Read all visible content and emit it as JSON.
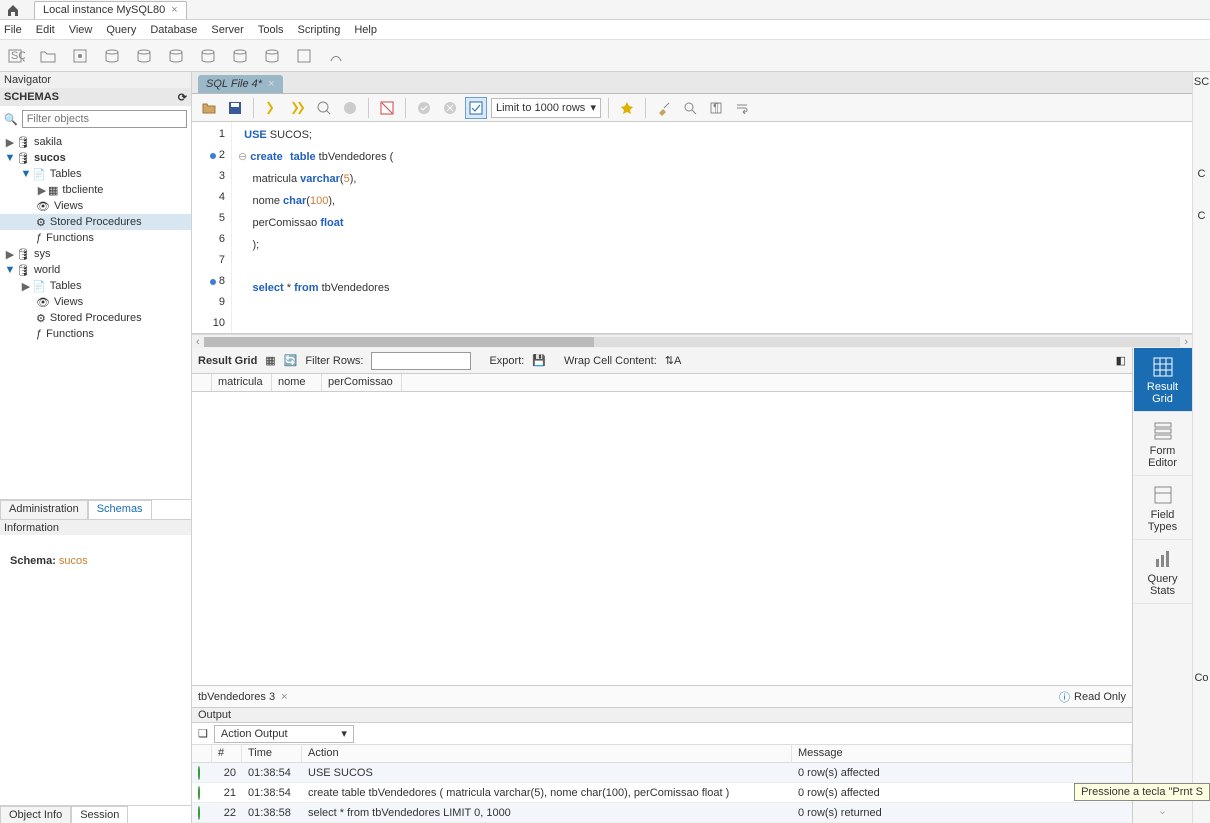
{
  "title_tab": "Local instance MySQL80",
  "menus": [
    "File",
    "Edit",
    "View",
    "Query",
    "Database",
    "Server",
    "Tools",
    "Scripting",
    "Help"
  ],
  "navigator_label": "Navigator",
  "schemas_label": "SCHEMAS",
  "filter_placeholder": "Filter objects",
  "tree": {
    "sakila": "sakila",
    "sucos": "sucos",
    "tables": "Tables",
    "tbcliente": "tbcliente",
    "views": "Views",
    "stored": "Stored Procedures",
    "functions": "Functions",
    "sys": "sys",
    "world": "world"
  },
  "nav_tabs": {
    "admin": "Administration",
    "schemas": "Schemas"
  },
  "info_label": "Information",
  "schema_prefix": "Schema: ",
  "schema_value": "sucos",
  "bottom_tabs": {
    "objinfo": "Object Info",
    "session": "Session"
  },
  "sql_tab": "SQL File 4*",
  "limit_label": "Limit to 1000 rows",
  "code": {
    "l1_kw": "USE",
    "l1_rest": " SUCOS;",
    "l2_kw1": "create",
    "l2_kw2": "table",
    "l2_rest": " tbVendedores (",
    "l3_a": "matricula ",
    "l3_kw": "varchar",
    "l3_b": "(",
    "l3_n": "5",
    "l3_c": "),",
    "l4_a": "nome ",
    "l4_kw": "char",
    "l4_b": "(",
    "l4_n": "100",
    "l4_c": "),",
    "l5_a": "perComissao ",
    "l5_kw": "float",
    "l6": ");",
    "l8_kw1": "select",
    "l8_b": " * ",
    "l8_kw2": "from",
    "l8_c": " tbVendedores"
  },
  "line_numbers": [
    "1",
    "2",
    "3",
    "4",
    "5",
    "6",
    "7",
    "8",
    "9",
    "10"
  ],
  "resultbar": {
    "label": "Result Grid",
    "filter": "Filter Rows:",
    "export": "Export:",
    "wrap": "Wrap Cell Content:"
  },
  "grid_cols": [
    "matricula",
    "nome",
    "perComissao"
  ],
  "side": {
    "result": "Result\nGrid",
    "form": "Form\nEditor",
    "field": "Field\nTypes",
    "query": "Query\nStats"
  },
  "result_tab": "tbVendedores 3",
  "readonly": "Read Only",
  "co_label": "Co",
  "sc_label": "SC",
  "c_label": "C",
  "q_label": "C",
  "output_label": "Output",
  "action_output": "Action Output",
  "out_head": {
    "hash": "#",
    "time": "Time",
    "action": "Action",
    "msg": "Message"
  },
  "out_rows": [
    {
      "n": "20",
      "t": "01:38:54",
      "a": "USE SUCOS",
      "m": "0 row(s) affected"
    },
    {
      "n": "21",
      "t": "01:38:54",
      "a": "create table tbVendedores ( matricula varchar(5), nome char(100), perComissao float )",
      "m": "0 row(s) affected"
    },
    {
      "n": "22",
      "t": "01:38:58",
      "a": "select * from tbVendedores LIMIT 0, 1000",
      "m": "0 row(s) returned"
    }
  ],
  "tooltip": "Pressione a tecla \"Prnt S"
}
